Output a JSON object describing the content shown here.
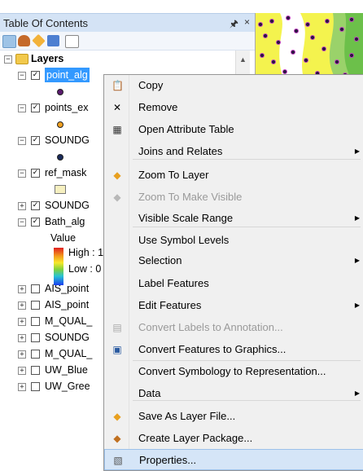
{
  "panel": {
    "title": "Table Of Contents",
    "pin_glyph": "↕",
    "close_glyph": "×",
    "toolbar_icons": [
      "list-by-drawing-order-icon",
      "list-by-source-icon",
      "list-by-visibility-icon",
      "list-by-selection-icon",
      "options-icon"
    ]
  },
  "tree": {
    "root_label": "Layers",
    "layers": [
      {
        "label": "point_alg",
        "checked": true,
        "expanded": true,
        "selected": true,
        "symbol_color": "#5a1a6e"
      },
      {
        "label": "points_ex",
        "checked": true,
        "expanded": true,
        "symbol_color": "#f0a020"
      },
      {
        "label": "SOUNDG",
        "checked": true,
        "expanded": true,
        "symbol_color": "#1a2a5a"
      },
      {
        "label": "ref_mask",
        "checked": true,
        "expanded": true,
        "symbol_color": "#f6f0c0"
      },
      {
        "label": "SOUNDG",
        "checked": true,
        "expanded": false
      },
      {
        "label": "Bath_alg",
        "checked": true,
        "expanded": true
      },
      {
        "label": "AIS_point",
        "checked": false,
        "expanded": false
      },
      {
        "label": "AIS_point",
        "checked": false,
        "expanded": false
      },
      {
        "label": "M_QUAL_",
        "checked": false,
        "expanded": false
      },
      {
        "label": "SOUNDG",
        "checked": false,
        "expanded": false
      },
      {
        "label": "M_QUAL_",
        "checked": false,
        "expanded": false
      },
      {
        "label": "UW_Blue",
        "checked": false,
        "expanded": false
      },
      {
        "label": "UW_Gree",
        "checked": false,
        "expanded": false
      }
    ],
    "raster_legend": {
      "value_label": "Value",
      "high_label": "High : 1",
      "low_label": "Low : 0"
    }
  },
  "context_menu": {
    "items": [
      {
        "label": "Copy",
        "icon": "copy-icon",
        "enabled": true,
        "submenu": false
      },
      {
        "label": "Remove",
        "icon": "remove-icon",
        "enabled": true,
        "submenu": false
      },
      {
        "label": "Open Attribute Table",
        "icon": "table-icon",
        "enabled": true,
        "submenu": false
      },
      {
        "label": "Joins and Relates",
        "icon": "",
        "enabled": true,
        "submenu": true
      },
      {
        "label": "Zoom To Layer",
        "icon": "zoom-to-layer-icon",
        "enabled": true,
        "submenu": false
      },
      {
        "label": "Zoom To Make Visible",
        "icon": "zoom-to-make-visible-icon",
        "enabled": false,
        "submenu": false
      },
      {
        "label": "Visible Scale Range",
        "icon": "",
        "enabled": true,
        "submenu": true
      },
      {
        "label": "Use Symbol Levels",
        "icon": "",
        "enabled": true,
        "submenu": false
      },
      {
        "label": "Selection",
        "icon": "",
        "enabled": true,
        "submenu": true
      },
      {
        "label": "Label Features",
        "icon": "",
        "enabled": true,
        "submenu": false
      },
      {
        "label": "Edit Features",
        "icon": "",
        "enabled": true,
        "submenu": true
      },
      {
        "label": "Convert Labels to Annotation...",
        "icon": "convert-labels-icon",
        "enabled": false,
        "submenu": false
      },
      {
        "label": "Convert Features to Graphics...",
        "icon": "convert-features-icon",
        "enabled": true,
        "submenu": false
      },
      {
        "label": "Convert Symbology to Representation...",
        "icon": "",
        "enabled": true,
        "submenu": false
      },
      {
        "label": "Data",
        "icon": "",
        "enabled": true,
        "submenu": true
      },
      {
        "label": "Save As Layer File...",
        "icon": "save-layer-icon",
        "enabled": true,
        "submenu": false
      },
      {
        "label": "Create Layer Package...",
        "icon": "layer-package-icon",
        "enabled": true,
        "submenu": false
      },
      {
        "label": "Properties...",
        "icon": "properties-icon",
        "enabled": true,
        "submenu": false,
        "highlighted": true
      }
    ],
    "arrow_glyph": "▶"
  },
  "colors": {
    "map_background": "#f4f34e",
    "map_dots": "#4a1060",
    "selection": "#3399ff",
    "menu_highlight": "#d5e5f7"
  }
}
